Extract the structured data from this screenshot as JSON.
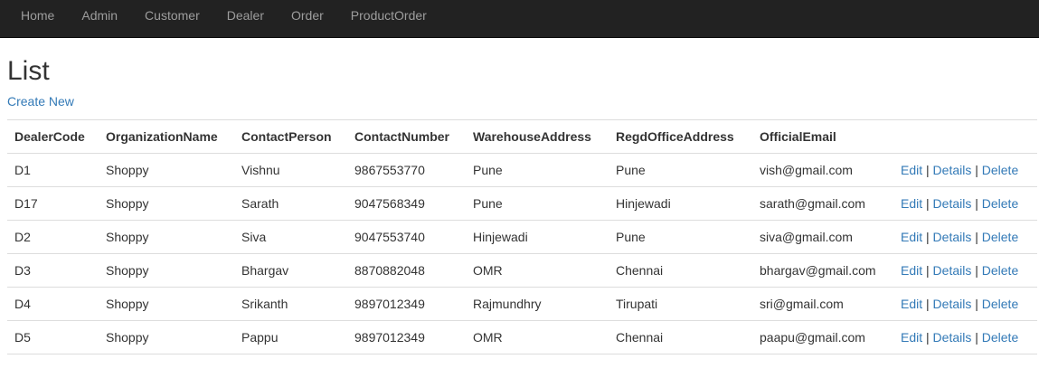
{
  "nav": [
    "Home",
    "Admin",
    "Customer",
    "Dealer",
    "Order",
    "ProductOrder"
  ],
  "page": {
    "title": "List",
    "create_label": "Create New"
  },
  "table": {
    "headers": [
      "DealerCode",
      "OrganizationName",
      "ContactPerson",
      "ContactNumber",
      "WarehouseAddress",
      "RegdOfficeAddress",
      "OfficialEmail",
      ""
    ],
    "rows": [
      [
        "D1",
        "Shoppy",
        "Vishnu",
        "9867553770",
        "Pune",
        "Pune",
        "vish@gmail.com"
      ],
      [
        "D17",
        "Shoppy",
        "Sarath",
        "9047568349",
        "Pune",
        "Hinjewadi",
        "sarath@gmail.com"
      ],
      [
        "D2",
        "Shoppy",
        "Siva",
        "9047553740",
        "Hinjewadi",
        "Pune",
        "siva@gmail.com"
      ],
      [
        "D3",
        "Shoppy",
        "Bhargav",
        "8870882048",
        "OMR",
        "Chennai",
        "bhargav@gmail.com"
      ],
      [
        "D4",
        "Shoppy",
        "Srikanth",
        "9897012349",
        "Rajmundhry",
        "Tirupati",
        "sri@gmail.com"
      ],
      [
        "D5",
        "Shoppy",
        "Pappu",
        "9897012349",
        "OMR",
        "Chennai",
        "paapu@gmail.com"
      ]
    ],
    "actions": {
      "edit": "Edit",
      "details": "Details",
      "delete": "Delete",
      "separator": "|"
    }
  },
  "colors": {
    "navbar_bg": "#222222",
    "nav_text": "#9d9d9d",
    "link": "#337ab7",
    "border": "#dddddd"
  }
}
